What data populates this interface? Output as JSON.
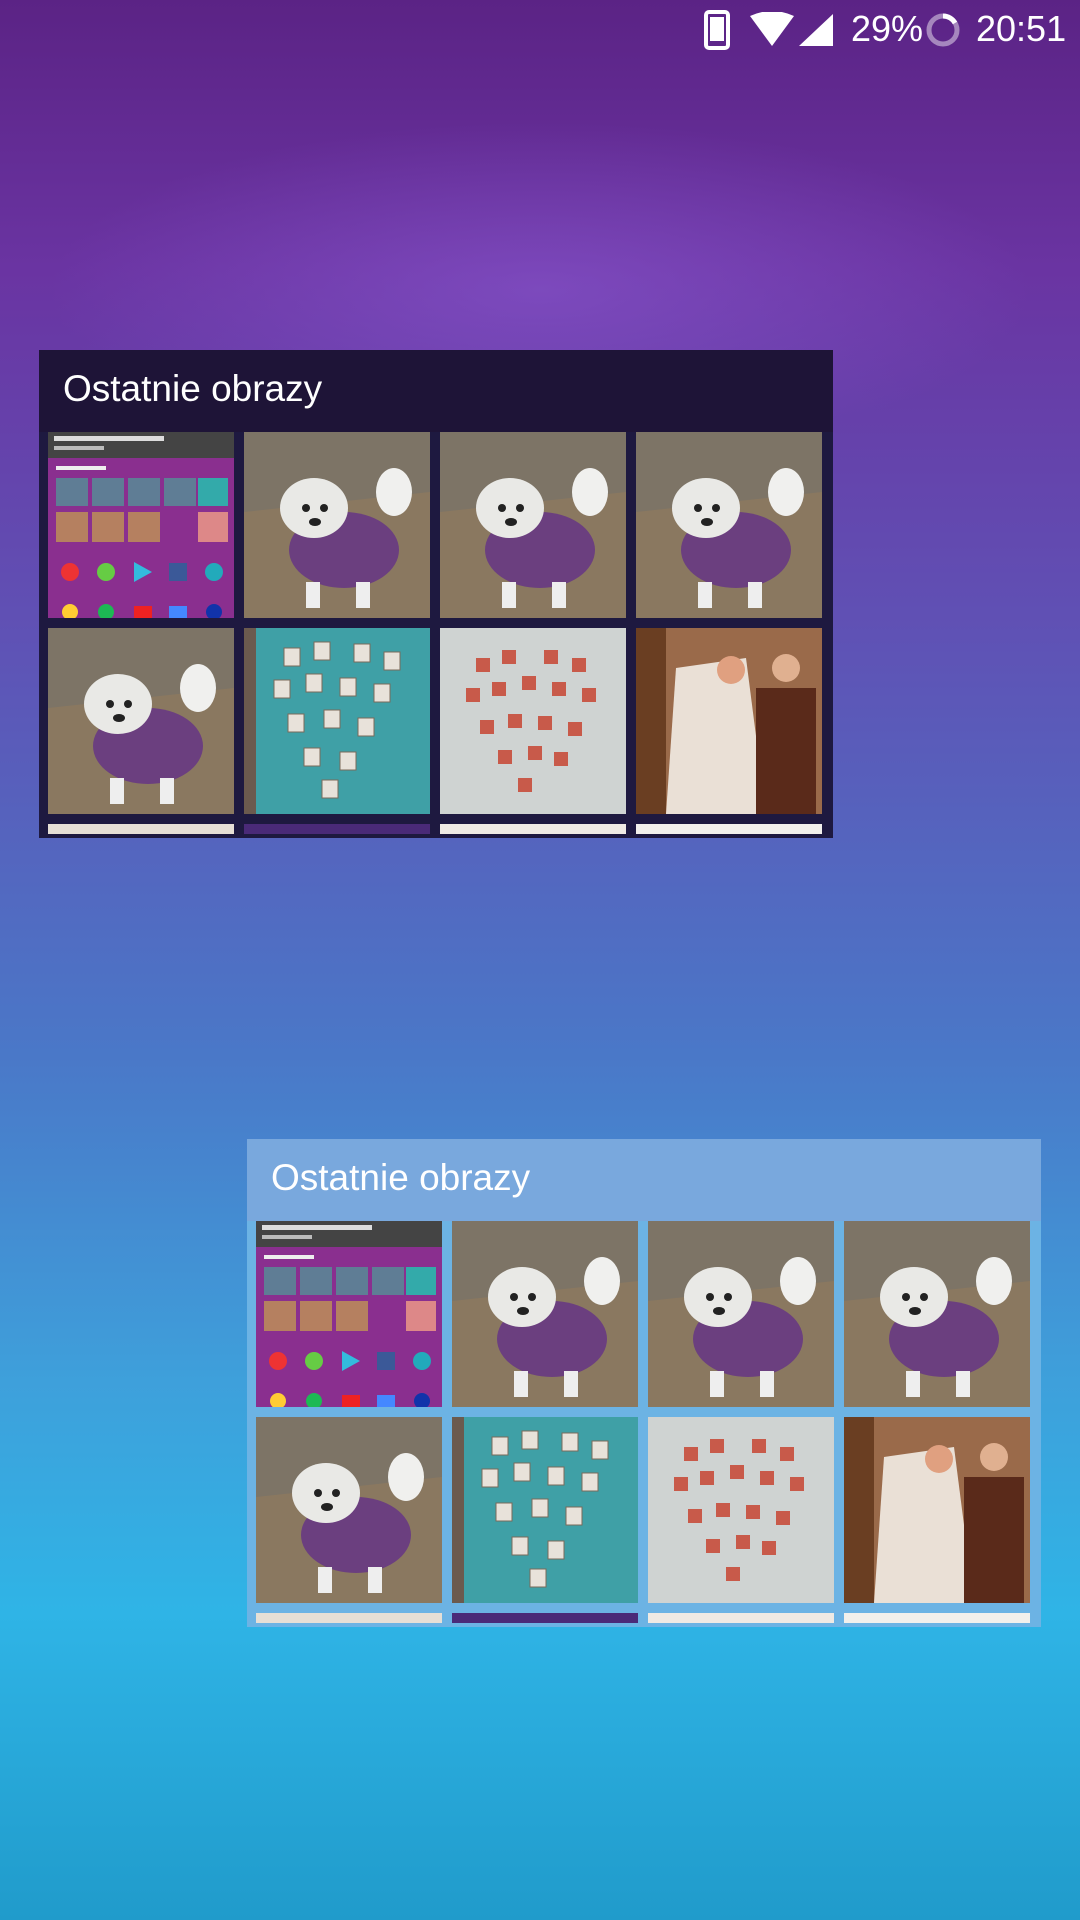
{
  "status_bar": {
    "battery_percent": "29%",
    "time": "20:51",
    "icons": [
      "phone-portrait-icon",
      "wifi-icon",
      "cell-signal-icon",
      "battery-charging-icon"
    ]
  },
  "widgets": [
    {
      "theme": "dark",
      "title": "Ostatnie obrazy",
      "thumbnails": [
        "screenshot-thumbnail",
        "dog-photo",
        "dog-photo",
        "dog-photo",
        "dog-photo",
        "heart-photo-wall-teal",
        "heart-photo-wall-white",
        "wedding-photo"
      ],
      "partial_row": [
        "partial-thumbnail",
        "partial-thumbnail",
        "partial-thumbnail",
        "partial-thumbnail"
      ]
    },
    {
      "theme": "light",
      "title": "Ostatnie obrazy",
      "thumbnails": [
        "screenshot-thumbnail",
        "dog-photo",
        "dog-photo",
        "dog-photo",
        "dog-photo",
        "heart-photo-wall-teal",
        "heart-photo-wall-white",
        "wedding-photo"
      ],
      "partial_row": [
        "partial-thumbnail",
        "partial-thumbnail",
        "partial-thumbnail",
        "partial-thumbnail"
      ]
    }
  ]
}
